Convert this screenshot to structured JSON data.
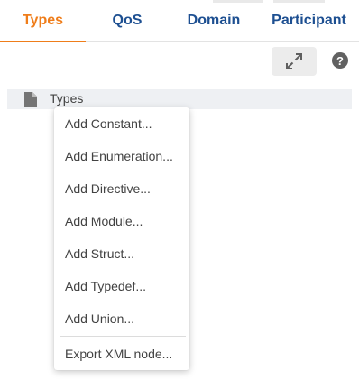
{
  "tabs": [
    {
      "label": "Types",
      "active": true
    },
    {
      "label": "QoS",
      "active": false
    },
    {
      "label": "Domain",
      "active": false
    },
    {
      "label": "Participant",
      "active": false
    }
  ],
  "toolbar": {
    "expand_icon": "expand-arrows-icon",
    "help_icon": "help-icon",
    "help_glyph": "?"
  },
  "tree": {
    "root_label": "Types",
    "root_icon": "file-icon"
  },
  "context_menu": {
    "items": [
      "Add Constant...",
      "Add Enumeration...",
      "Add Directive...",
      "Add Module...",
      "Add Struct...",
      "Add Typedef...",
      "Add Union..."
    ],
    "export_item": "Export XML node..."
  },
  "colors": {
    "accent_orange": "#ef7d1a",
    "tab_blue": "#1d4f91",
    "text_gray": "#424242",
    "tree_row_bg": "#eef0f3"
  }
}
